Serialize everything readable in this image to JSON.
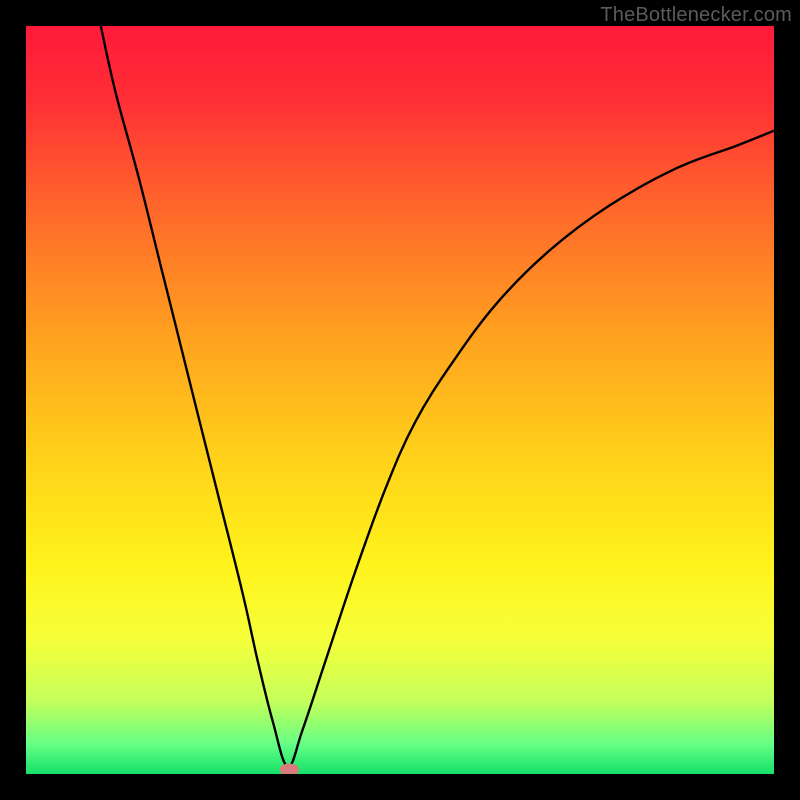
{
  "watermark": "TheBottlenecker.com",
  "chart_data": {
    "type": "line",
    "title": "",
    "xlabel": "",
    "ylabel": "",
    "xlim": [
      0,
      100
    ],
    "ylim": [
      0,
      100
    ],
    "grid": false,
    "background": "gradient red→orange→yellow→green (vertical)",
    "series": [
      {
        "name": "bottleneck-curve",
        "note": "V-shaped curve touching y≈0 near x≈35; values estimated from plot pixels as percentage of axis height",
        "x": [
          10,
          12,
          15,
          18,
          20,
          23,
          26,
          29,
          31,
          33,
          35,
          37,
          40,
          44,
          48,
          52,
          57,
          63,
          70,
          78,
          87,
          95,
          100
        ],
        "values": [
          100,
          91,
          80,
          68,
          60,
          48,
          36,
          24,
          15,
          7,
          1,
          6,
          15,
          27,
          38,
          47,
          55,
          63,
          70,
          76,
          81,
          84,
          86
        ]
      }
    ],
    "gradient_stops": [
      {
        "offset": 0.0,
        "color": "#ff1a3a"
      },
      {
        "offset": 0.1,
        "color": "#ff2f35"
      },
      {
        "offset": 0.25,
        "color": "#ff6a2a"
      },
      {
        "offset": 0.42,
        "color": "#ffa31f"
      },
      {
        "offset": 0.58,
        "color": "#ffd219"
      },
      {
        "offset": 0.72,
        "color": "#fff31c"
      },
      {
        "offset": 0.82,
        "color": "#f6ff3a"
      },
      {
        "offset": 0.9,
        "color": "#c7ff5a"
      },
      {
        "offset": 0.96,
        "color": "#66ff84"
      },
      {
        "offset": 1.0,
        "color": "#14e06a"
      }
    ],
    "marker": {
      "note": "small pink oval marker at curve minimum",
      "x": 35.2,
      "y": 0.6,
      "rx": 1.3,
      "ry": 0.8,
      "fill": "#d77b7b"
    }
  }
}
